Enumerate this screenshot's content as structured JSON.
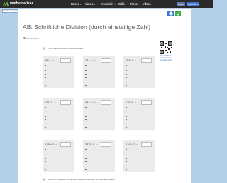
{
  "brand": {
    "name": "mathematiker",
    "accent": "#6fbe44"
  },
  "nav": {
    "items": [
      "Kurse",
      "Videos",
      "Interaktiv",
      "Wiki",
      "Preise",
      "Infos"
    ],
    "login": "Login",
    "register": "Registrieren"
  },
  "search": {
    "placeholder": "Suche im Angebot"
  },
  "page": {
    "title": "AB: Schriftliche Division (durch einstellige Zahl)",
    "author": "Mathematiker",
    "qr_caption": "AB: Schriftliche Division durch einstellige Zahl"
  },
  "task": {
    "number": "1",
    "text": "Führe die schriftlichen Divisionen aus:"
  },
  "problems": [
    {
      "expr": "98:2 =",
      "answer_placeholder": ""
    },
    {
      "expr": "161:7 =",
      "answer_placeholder": ""
    },
    {
      "expr": "180:5 =",
      "answer_placeholder": ""
    },
    {
      "expr": "576:3 =",
      "answer_placeholder": ""
    },
    {
      "expr": "504:8 =",
      "answer_placeholder": ""
    },
    {
      "expr": "210:6 =",
      "answer_placeholder": ""
    },
    {
      "expr": "2180:5 =",
      "answer_placeholder": ""
    },
    {
      "expr": "3825:9 =",
      "answer_placeholder": ""
    },
    {
      "expr": "2184:7 =",
      "answer_placeholder": ""
    }
  ],
  "footer_task": {
    "number": "2",
    "text": "Erkläre mit eigenen Worten, wie das Verfahren der schriftlichen Division"
  },
  "colors": {
    "background": "#b4cfe9",
    "topbar": "#2b2b2b",
    "print_button": "#3d7bd3",
    "share_button": "#3faa4a",
    "card": "#ebebeb"
  }
}
